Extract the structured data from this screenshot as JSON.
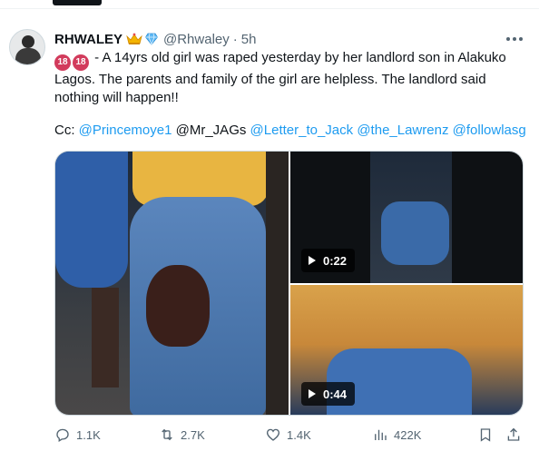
{
  "tweet": {
    "display_name": "RHWALEY",
    "handle": "@Rhwaley",
    "separator": "·",
    "time": "5h",
    "badge_text": "18",
    "body_text": " - A 14yrs old girl was raped yesterday by her landlord son in Alakuko Lagos. The parents and family of the girl are helpless. The landlord said nothing will happen!!",
    "cc_prefix": "Cc: ",
    "mentions": {
      "m1": "@Princemoye1",
      "m2_plain": "@Mr_JAGs",
      "m3": "@Letter_to_Jack",
      "m4": "@the_Lawrenz",
      "m5": "@followlasg"
    }
  },
  "media": {
    "video1_duration": "0:22",
    "video2_duration": "0:44"
  },
  "actions": {
    "replies": "1.1K",
    "reposts": "2.7K",
    "likes": "1.4K",
    "views": "422K"
  },
  "icons": [
    "crown-emoji-icon",
    "verified-diamond-icon",
    "more-icon",
    "play-icon",
    "reply-icon",
    "repost-icon",
    "like-icon",
    "views-icon",
    "bookmark-icon",
    "share-icon"
  ],
  "colors": {
    "link": "#1d9bf0",
    "muted": "#536471",
    "badge": "#d23b5c"
  }
}
